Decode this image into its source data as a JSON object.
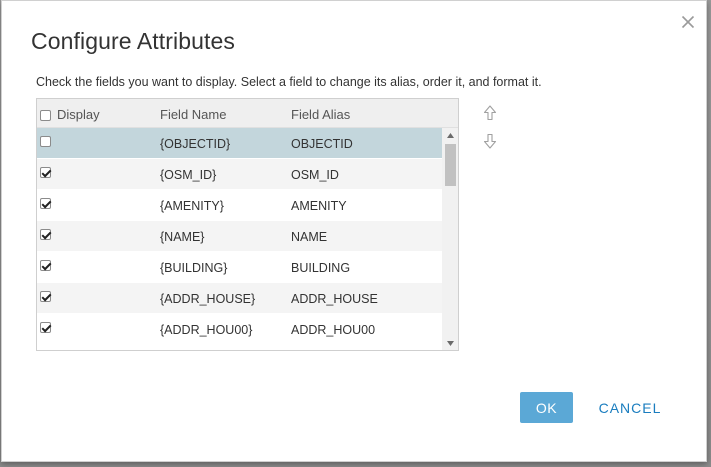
{
  "dialog": {
    "title": "Configure Attributes",
    "instructions": "Check the fields you want to display. Select a field to change its alias, order it, and format it.",
    "close_icon": "close-icon"
  },
  "grid": {
    "columns": {
      "display": "Display",
      "field_name": "Field Name",
      "field_alias": "Field Alias"
    },
    "rows": [
      {
        "checked": false,
        "field_name": "{OBJECTID}",
        "field_alias": "OBJECTID",
        "selected": true
      },
      {
        "checked": true,
        "field_name": "{OSM_ID}",
        "field_alias": "OSM_ID",
        "selected": false
      },
      {
        "checked": true,
        "field_name": "{AMENITY}",
        "field_alias": "AMENITY",
        "selected": false
      },
      {
        "checked": true,
        "field_name": "{NAME}",
        "field_alias": "NAME",
        "selected": false
      },
      {
        "checked": true,
        "field_name": "{BUILDING}",
        "field_alias": "BUILDING",
        "selected": false
      },
      {
        "checked": true,
        "field_name": "{ADDR_HOUSE}",
        "field_alias": "ADDR_HOUSE",
        "selected": false
      },
      {
        "checked": true,
        "field_name": "{ADDR_HOU00}",
        "field_alias": "ADDR_HOU00",
        "selected": false
      }
    ]
  },
  "order_controls": {
    "up_icon": "arrow-up-icon",
    "down_icon": "arrow-down-icon"
  },
  "footer": {
    "ok_label": "OK",
    "cancel_label": "CANCEL"
  },
  "colors": {
    "selected_row": "#c3d6dc",
    "ok_button": "#5ba8d6",
    "cancel_text": "#1a7dbf"
  }
}
